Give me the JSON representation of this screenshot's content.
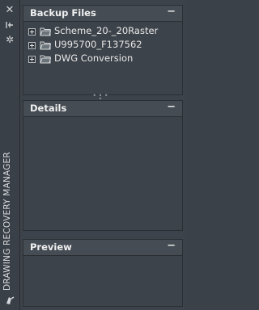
{
  "strip": {
    "title": "DRAWING RECOVERY MANAGER",
    "icons": [
      "close-icon",
      "auto-hide-icon",
      "properties-icon",
      "app-icon"
    ]
  },
  "panes": {
    "backup": {
      "title": "Backup Files",
      "collapse": "−",
      "items": [
        {
          "label": "Scheme_20-_20Raster"
        },
        {
          "label": "U995700_F137562"
        },
        {
          "label": "DWG Conversion"
        }
      ]
    },
    "details": {
      "title": "Details",
      "collapse": "−"
    },
    "preview": {
      "title": "Preview",
      "collapse": "−"
    }
  },
  "colors": {
    "background": "#3d434a",
    "header": "#454c54",
    "border": "#2b2f34",
    "text": "#e6e6e6"
  }
}
